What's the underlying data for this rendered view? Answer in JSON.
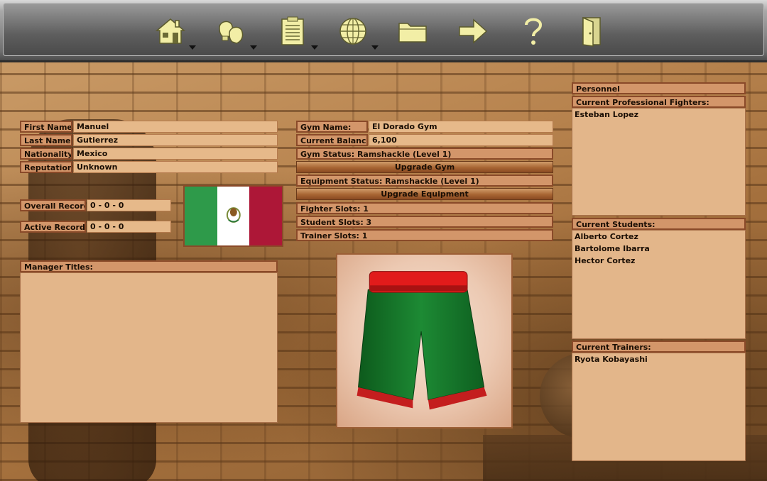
{
  "toolbar": {
    "buttons": [
      {
        "icon": "home-icon",
        "has_menu": true
      },
      {
        "icon": "boxing-gloves-icon",
        "has_menu": true
      },
      {
        "icon": "clipboard-icon",
        "has_menu": true
      },
      {
        "icon": "globe-icon",
        "has_menu": true
      },
      {
        "icon": "folder-icon",
        "has_menu": false
      },
      {
        "icon": "arrow-right-icon",
        "has_menu": false
      },
      {
        "icon": "help-icon",
        "has_menu": false
      },
      {
        "icon": "exit-door-icon",
        "has_menu": false
      }
    ]
  },
  "manager": {
    "first_name_label": "First Name",
    "first_name": "Manuel",
    "last_name_label": "Last Name",
    "last_name": "Gutierrez",
    "nationality_label": "Nationality",
    "nationality": "Mexico",
    "reputation_label": "Reputation",
    "reputation": "Unknown",
    "overall_record_label": "Overall Record",
    "overall_record": "0 - 0 - 0",
    "active_record_label": "Active Record",
    "active_record": "0 - 0 - 0",
    "titles_label": "Manager Titles:",
    "flag_colors": [
      "#2e9a4a",
      "#ffffff",
      "#ad1737"
    ]
  },
  "gym": {
    "name_label": "Gym Name:",
    "name": "El Dorado Gym",
    "balance_label": "Current Balance",
    "balance": "6,100",
    "status": "Gym Status: Ramshackle (Level 1)",
    "upgrade_gym": "Upgrade Gym",
    "equipment_status": "Equipment Status: Ramshackle (Level 1)",
    "upgrade_equipment": "Upgrade Equipment",
    "fighter_slots": "Fighter Slots: 1",
    "student_slots": "Student Slots: 3",
    "trainer_slots": "Trainer Slots: 1"
  },
  "personnel": {
    "title": "Personnel",
    "fighters_label": "Current Professional Fighters:",
    "fighters": [
      "Esteban Lopez"
    ],
    "students_label": "Current Students:",
    "students": [
      "Alberto Cortez",
      "Bartolome Ibarra",
      "Hector Cortez"
    ],
    "trainers_label": "Current Trainers:",
    "trainers": [
      "Ryota Kobayashi"
    ]
  },
  "colors": {
    "label_bg": "#d3966a",
    "value_bg": "#e6b98a",
    "border": "#8a4a29",
    "icon": "#f2eea6"
  }
}
